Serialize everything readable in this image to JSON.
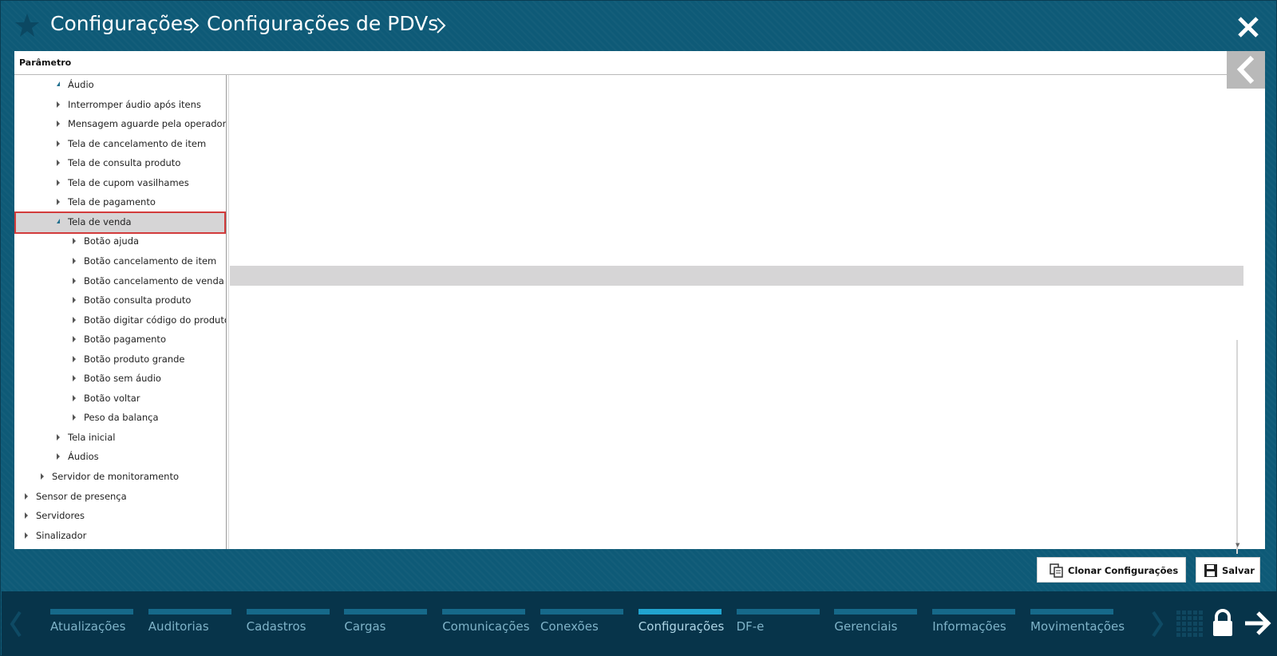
{
  "header": {
    "breadcrumb_1": "Configurações",
    "breadcrumb_2": "Configurações de PDVs",
    "icons": [
      "star-icon",
      "chevron-right-icon",
      "close-icon"
    ]
  },
  "panel": {
    "column_header": "Parâmetro"
  },
  "tree": {
    "items": [
      {
        "label": "Áudio",
        "expanded": true
      },
      {
        "label": "Interromper áudio após itens",
        "expanded": false
      },
      {
        "label": "Mensagem aguarde pela operadora",
        "expanded": false
      },
      {
        "label": "Tela de cancelamento de item",
        "expanded": false
      },
      {
        "label": "Tela de consulta produto",
        "expanded": false
      },
      {
        "label": "Tela de cupom vasilhames",
        "expanded": false
      },
      {
        "label": "Tela de pagamento",
        "expanded": false
      },
      {
        "label": "Tela de venda",
        "expanded": true,
        "selected": true
      },
      {
        "label": "Botão ajuda",
        "expanded": false
      },
      {
        "label": "Botão cancelamento de item",
        "expanded": false
      },
      {
        "label": "Botão cancelamento de venda",
        "expanded": false
      },
      {
        "label": "Botão consulta produto",
        "expanded": false
      },
      {
        "label": "Botão digitar código do produto",
        "expanded": false
      },
      {
        "label": "Botão pagamento",
        "expanded": false
      },
      {
        "label": "Botão produto grande",
        "expanded": false
      },
      {
        "label": "Botão sem áudio",
        "expanded": false
      },
      {
        "label": "Botão voltar",
        "expanded": false
      },
      {
        "label": "Peso da balança",
        "expanded": false
      },
      {
        "label": "Tela inicial",
        "expanded": false
      },
      {
        "label": "Áudios",
        "expanded": false
      },
      {
        "label": "Servidor de monitoramento",
        "expanded": false
      },
      {
        "label": "Sensor de presença",
        "expanded": false
      },
      {
        "label": "Servidores",
        "expanded": false
      },
      {
        "label": "Sinalizador",
        "expanded": false
      }
    ]
  },
  "actions": {
    "clone_label": "Clonar Configurações",
    "save_label": "Salvar"
  },
  "nav": {
    "tabs": [
      {
        "label": "Atualizações",
        "active": false
      },
      {
        "label": "Auditorias",
        "active": false
      },
      {
        "label": "Cadastros",
        "active": false
      },
      {
        "label": "Cargas",
        "active": false
      },
      {
        "label": "Comunicações",
        "active": false
      },
      {
        "label": "Conexões",
        "active": false
      },
      {
        "label": "Configurações",
        "active": true
      },
      {
        "label": "DF-e",
        "active": false
      },
      {
        "label": "Gerenciais",
        "active": false
      },
      {
        "label": "Informações",
        "active": false
      },
      {
        "label": "Movimentações",
        "active": false
      }
    ]
  },
  "colors": {
    "background": "#0e5a77",
    "nav_background": "#07344a",
    "tab_bar": "#16698a",
    "tab_bar_active": "#21a4cf",
    "selection": "#d6d5d6",
    "selection_outline": "#d23b3b"
  }
}
